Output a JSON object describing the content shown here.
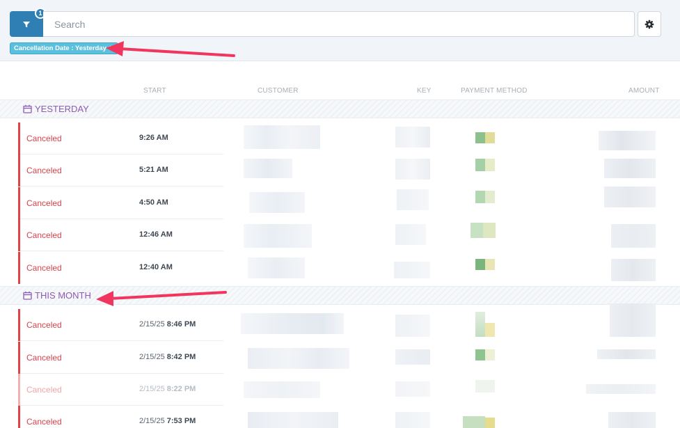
{
  "toolbar": {
    "filter_count": "1",
    "search_placeholder": "Search"
  },
  "active_filter": {
    "label": "Cancellation Date : Yesterday",
    "remove_glyph": "✖"
  },
  "columns": {
    "start": "START",
    "customer": "CUSTOMER",
    "key": "KEY",
    "payment_method": "PAYMENT METHOD",
    "amount": "AMOUNT"
  },
  "groups": [
    {
      "title": "YESTERDAY",
      "icon": "calendar-icon",
      "rows": [
        {
          "status": "Canceled",
          "date": "",
          "time": "9:26 AM"
        },
        {
          "status": "Canceled",
          "date": "",
          "time": "5:21 AM"
        },
        {
          "status": "Canceled",
          "date": "",
          "time": "4:50 AM"
        },
        {
          "status": "Canceled",
          "date": "",
          "time": "12:46 AM"
        },
        {
          "status": "Canceled",
          "date": "",
          "time": "12:40 AM"
        }
      ]
    },
    {
      "title": "THIS MONTH",
      "icon": "calendar-icon",
      "rows": [
        {
          "status": "Canceled",
          "date": "2/15/25",
          "time": "8:46 PM"
        },
        {
          "status": "Canceled",
          "date": "2/15/25",
          "time": "8:42 PM"
        },
        {
          "status": "Canceled",
          "date": "2/15/25",
          "time": "8:22 PM"
        },
        {
          "status": "Canceled",
          "date": "2/15/25",
          "time": "7:53 PM"
        }
      ]
    }
  ],
  "colors": {
    "primary": "#2f7fb5",
    "chip": "#5bc0de",
    "status_canceled": "#d8434a",
    "group_header": "#8e5bb4",
    "annotation_arrow": "#f0365f"
  }
}
